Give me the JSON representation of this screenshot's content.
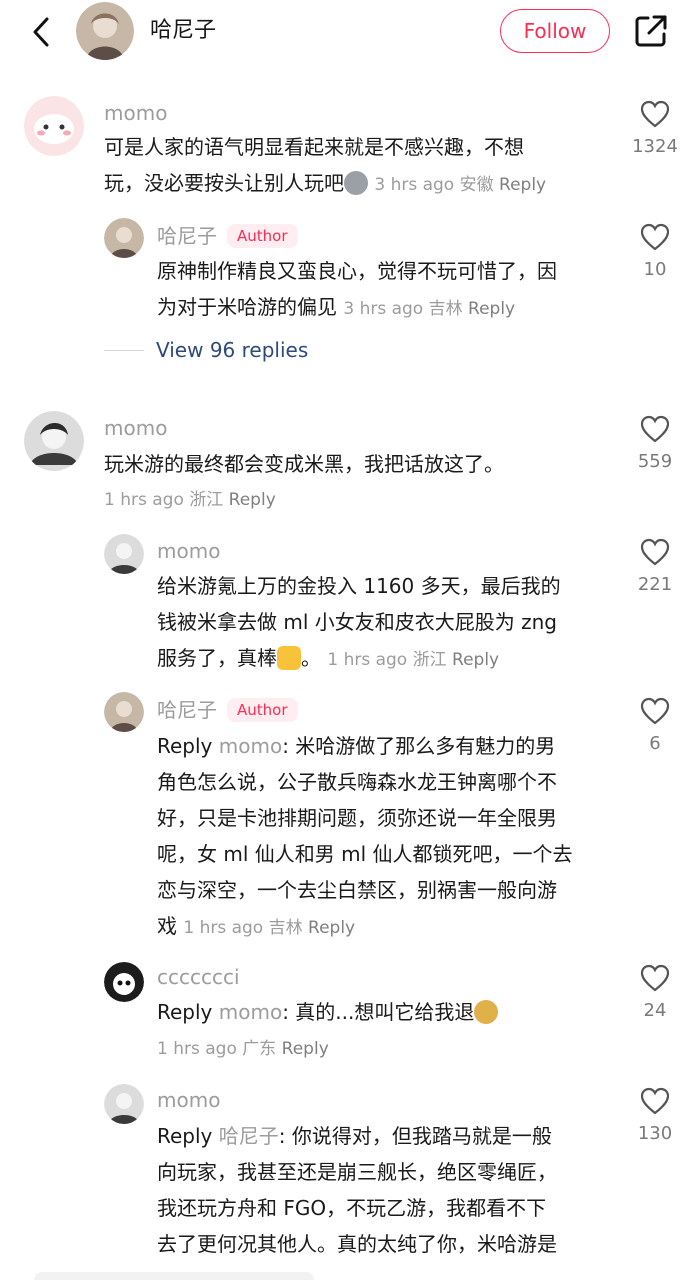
{
  "header": {
    "title": "哈尼子",
    "follow_label": "Follow"
  },
  "view_replies_label": "View 96 replies",
  "comments": [
    {
      "user": "momo",
      "line1": "可是人家的语气明显看起来就是不感兴趣，不想",
      "line2": "玩，没必要按头让别人玩吧",
      "time": "3 hrs ago 安徽",
      "reply": "Reply",
      "likes": "1324"
    },
    {
      "user": "哈尼子",
      "badge": "Author",
      "line1": "原神制作精良又蛮良心，觉得不玩可惜了，因",
      "line2": "为对于米哈游的偏见",
      "time": "3 hrs ago 吉林",
      "reply": "Reply",
      "likes": "10"
    },
    {
      "user": "momo",
      "line1": "玩米游的最终都会变成米黑，我把话放这了。",
      "time": "1 hrs ago 浙江",
      "reply": "Reply",
      "likes": "559"
    },
    {
      "user": "momo",
      "line1": "给米游氪上万的金投入 1160 多天，最后我的",
      "line2": "钱被米拿去做 ml 小女友和皮衣大屁股为 zng",
      "line3": "服务了，真棒",
      "line3_tail": "。",
      "time": "1 hrs ago 浙江",
      "reply": "Reply",
      "likes": "221"
    },
    {
      "user": "哈尼子",
      "badge": "Author",
      "reply_prefix": "Reply",
      "reply_target": "momo",
      "line1": ": 米哈游做了那么多有魅力的男",
      "line2": "角色怎么说，公子散兵嗨森水龙王钟离哪个不",
      "line3": "好，只是卡池排期问题，须弥还说一年全限男",
      "line4": "呢，女 ml 仙人和男 ml 仙人都锁死吧，一个去",
      "line5": "恋与深空，一个去尘白禁区，别祸害一般向游",
      "line6": "戏",
      "time": "1 hrs ago 吉林",
      "reply": "Reply",
      "likes": "6"
    },
    {
      "user": "ccccccci",
      "reply_prefix": "Reply",
      "reply_target": "momo",
      "line1": ": 真的...想叫它给我退",
      "time": "1 hrs ago 广东",
      "reply": "Reply",
      "likes": "24"
    },
    {
      "user": "momo",
      "reply_prefix": "Reply",
      "reply_target": "哈尼子",
      "line1": ": 你说得对，但我踏马就是一般",
      "line2": "向玩家，我甚至还是崩三舰长，绝区零绳匠，",
      "line3": "我还玩方舟和 FGO，不玩乙游，我都看不下",
      "line4": "去了更何况其他人。真的太纯了你，米哈游是",
      "likes": "130"
    }
  ],
  "colors": {
    "accent": "#fe2c55",
    "muted": "#9c9c9c",
    "link": "#2f4a7a"
  }
}
